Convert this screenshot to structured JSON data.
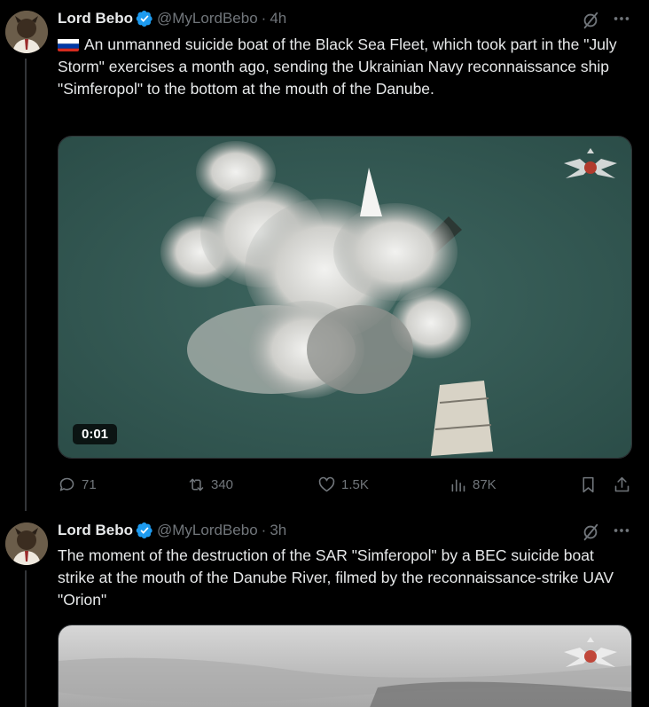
{
  "tweets": [
    {
      "author_name": "Lord Bebo",
      "handle": "@MyLordBebo",
      "separator": "·",
      "time": "4h",
      "flag_icon": "russia-flag-icon",
      "text": "An unmanned suicide boat of the Black Sea Fleet, which took part in the \"July Storm\" exercises a month ago, sending the Ukrainian Navy reconnaissance ship \"Simferopol\" to the bottom at the mouth of the Danube.",
      "video_duration": "0:01",
      "replies": "71",
      "reposts": "340",
      "likes": "1.5K",
      "views": "87K"
    },
    {
      "author_name": "Lord Bebo",
      "handle": "@MyLordBebo",
      "separator": "·",
      "time": "3h",
      "text": "The moment of the destruction of the SAR \"Simferopol\" by a BEC suicide boat strike at the mouth of the Danube River, filmed by the reconnaissance-strike UAV \"Orion\""
    }
  ],
  "colors": {
    "background": "#000000",
    "text_primary": "#e7e9ea",
    "text_secondary": "#71767b",
    "verified_blue": "#1d9bf0",
    "divider": "#2f3336"
  }
}
